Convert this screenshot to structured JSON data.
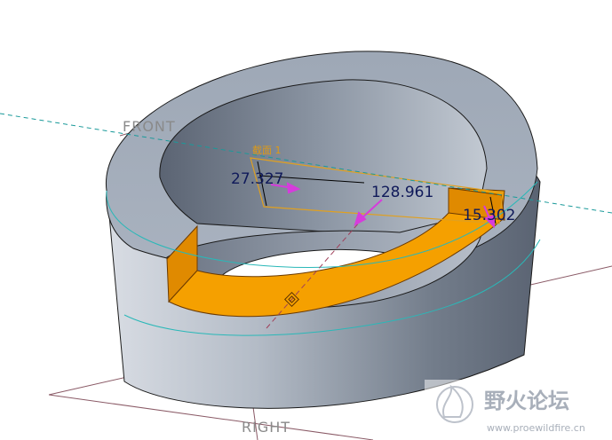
{
  "datum_planes": {
    "front": "FRONT",
    "right": "RIGHT"
  },
  "section": {
    "label": "截面 1"
  },
  "dimensions": [
    {
      "id": "depth",
      "value": "27.327"
    },
    {
      "id": "width",
      "value": "128.961"
    },
    {
      "id": "height",
      "value": "15.302"
    }
  ],
  "watermark": {
    "title": "野火论坛",
    "url": "www.proewildfire.cn"
  },
  "colors": {
    "section_fill": "#f5a000",
    "dimension_text": "#101a5a",
    "arrow": "#d63cdc",
    "plane_line": "#8a5a66",
    "axis_line": "#1a9a9a"
  }
}
